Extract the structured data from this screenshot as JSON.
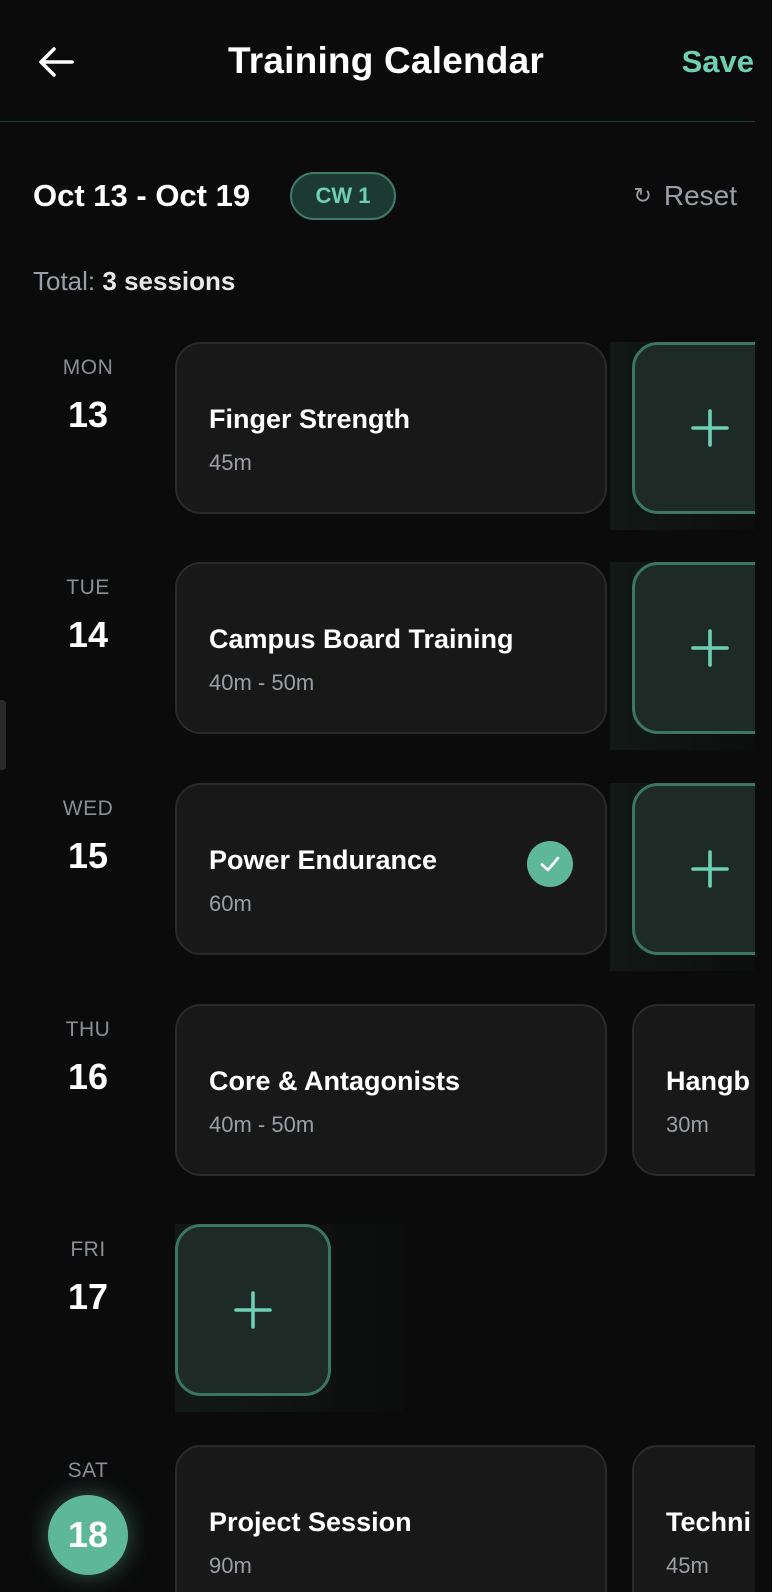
{
  "header": {
    "title": "Training Calendar",
    "save_label": "Save",
    "back_icon": "arrow-left-icon"
  },
  "week": {
    "range": "Oct 13 - Oct 19",
    "badge": "CW 1",
    "reset_label": "Reset",
    "reset_icon": "↻"
  },
  "total": {
    "label": "Total:",
    "value": "3 sessions"
  },
  "days": [
    {
      "name": "MON",
      "num": "13",
      "sessions": [
        {
          "title": "Finger Strength",
          "duration": "45m",
          "completed": false
        }
      ],
      "add": true
    },
    {
      "name": "TUE",
      "num": "14",
      "sessions": [
        {
          "title": "Campus Board Training",
          "duration": "40m - 50m",
          "completed": false
        }
      ],
      "add": true
    },
    {
      "name": "WED",
      "num": "15",
      "sessions": [
        {
          "title": "Power Endurance",
          "duration": "60m",
          "completed": true
        }
      ],
      "add": true
    },
    {
      "name": "THU",
      "num": "16",
      "sessions": [
        {
          "title": "Core & Antagonists",
          "duration": "40m - 50m",
          "completed": false
        },
        {
          "title": "Hangb",
          "duration": "30m",
          "completed": false
        }
      ],
      "add": false
    },
    {
      "name": "FRI",
      "num": "17",
      "sessions": [],
      "add": true
    },
    {
      "name": "SAT",
      "num": "18",
      "today": true,
      "sessions": [
        {
          "title": "Project Session",
          "duration": "90m",
          "completed": false
        },
        {
          "title": "Techni",
          "duration": "45m",
          "completed": false
        }
      ],
      "add": false
    }
  ],
  "colors": {
    "accent": "#6fcfb3",
    "accent_dark": "#5fb79a",
    "background": "#0b0b0b",
    "card": "#181818"
  }
}
